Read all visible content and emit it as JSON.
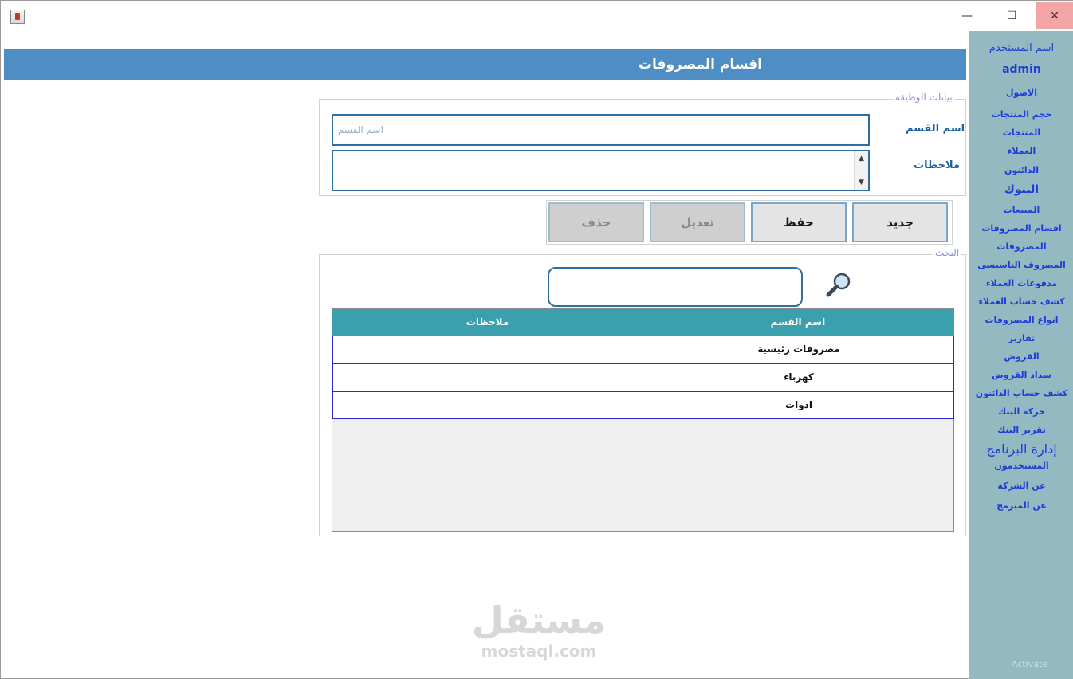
{
  "window": {
    "minimize": "—",
    "maximize": "☐",
    "close": "✕"
  },
  "sidebar": {
    "user_label": "اسم المستخدم",
    "user_name": "admin",
    "items": [
      {
        "label": "الاصول"
      },
      {
        "label": "حجم المنتجات"
      },
      {
        "label": "المنتجات"
      },
      {
        "label": "العملاء"
      },
      {
        "label": "الدائنون"
      },
      {
        "label": "البنوك"
      },
      {
        "label": "المبيعات"
      },
      {
        "label": "اقسام المصروفات"
      },
      {
        "label": "المصروفات"
      },
      {
        "label": "المصروف التاسيسى"
      },
      {
        "label": "مدفوعات العملاء"
      },
      {
        "label": "كشف حساب العملاء"
      },
      {
        "label": "انواع المصروفات"
      },
      {
        "label": "تقارير"
      },
      {
        "label": "القروض"
      },
      {
        "label": "سداد القروض"
      },
      {
        "label": "كشف حساب الدائنون"
      },
      {
        "label": "حركة البنك"
      },
      {
        "label": "تقرير البنك"
      },
      {
        "label": "إدارة البرنامج"
      },
      {
        "label": "المستخدمون"
      },
      {
        "label": "عن الشركة"
      },
      {
        "label": "عن المبرمج"
      }
    ]
  },
  "header": {
    "title": "اقسام المصروفات"
  },
  "form": {
    "group_title": "بيانات الوظيفة",
    "name_label": "اسم القسم",
    "name_placeholder": "اسم القسم",
    "name_value": "",
    "notes_label": "ملاحظات",
    "notes_value": ""
  },
  "actions": {
    "new_label": "جديد",
    "save_label": "حفظ",
    "edit_label": "تعديل",
    "delete_label": "حذف"
  },
  "search": {
    "group_title": "البحث",
    "value": ""
  },
  "table": {
    "columns": [
      "اسم القسم",
      "ملاحظات"
    ],
    "rows": [
      {
        "name": "مصروفات رئيسية",
        "notes": ""
      },
      {
        "name": "كهرباء",
        "notes": ""
      },
      {
        "name": "ادوات",
        "notes": ""
      }
    ]
  },
  "watermark": {
    "arabic": "مستقل",
    "latin": "mostaql.com"
  },
  "overlay": {
    "activate": "Activate"
  }
}
